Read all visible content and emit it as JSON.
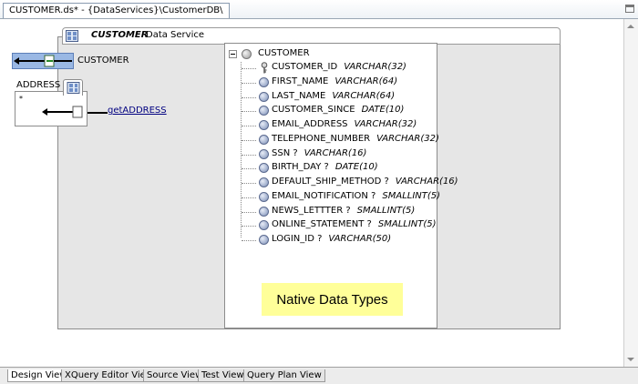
{
  "window": {
    "tab_title": "CUSTOMER.ds* - {DataServices}\\CustomerDB\\"
  },
  "data_service": {
    "name": "CUSTOMER",
    "subtitle": "Data Service"
  },
  "functions": {
    "read_function_label": "CUSTOMER",
    "relationship_label": "ADDRESS",
    "navigation_function_label": "getADDRESS"
  },
  "schema": {
    "root_label": "CUSTOMER",
    "fields": [
      {
        "name": "CUSTOMER_ID",
        "type": "VARCHAR(32)",
        "icon": "key-icon"
      },
      {
        "name": "FIRST_NAME",
        "type": "VARCHAR(64)",
        "icon": "element-icon"
      },
      {
        "name": "LAST_NAME",
        "type": "VARCHAR(64)",
        "icon": "element-icon"
      },
      {
        "name": "CUSTOMER_SINCE",
        "type": "DATE(10)",
        "icon": "element-icon"
      },
      {
        "name": "EMAIL_ADDRESS",
        "type": "VARCHAR(32)",
        "icon": "element-icon"
      },
      {
        "name": "TELEPHONE_NUMBER",
        "type": "VARCHAR(32)",
        "icon": "element-icon"
      },
      {
        "name": "SSN ?",
        "type": "VARCHAR(16)",
        "icon": "element-icon"
      },
      {
        "name": "BIRTH_DAY ?",
        "type": "DATE(10)",
        "icon": "element-icon"
      },
      {
        "name": "DEFAULT_SHIP_METHOD ?",
        "type": "VARCHAR(16)",
        "icon": "element-icon"
      },
      {
        "name": "EMAIL_NOTIFICATION ?",
        "type": "SMALLINT(5)",
        "icon": "element-icon"
      },
      {
        "name": "NEWS_LETTTER ?",
        "type": "SMALLINT(5)",
        "icon": "element-icon"
      },
      {
        "name": "ONLINE_STATEMENT ?",
        "type": "SMALLINT(5)",
        "icon": "element-icon"
      },
      {
        "name": "LOGIN_ID ?",
        "type": "VARCHAR(50)",
        "icon": "element-icon"
      }
    ]
  },
  "callout": {
    "text": "Native Data Types",
    "color": "#ffff99"
  },
  "bottom_tabs": [
    {
      "label": "Design View",
      "active": true
    },
    {
      "label": "XQuery Editor View",
      "active": false
    },
    {
      "label": "Source View",
      "active": false
    },
    {
      "label": "Test View",
      "active": false
    },
    {
      "label": "Query Plan View",
      "active": false
    }
  ]
}
